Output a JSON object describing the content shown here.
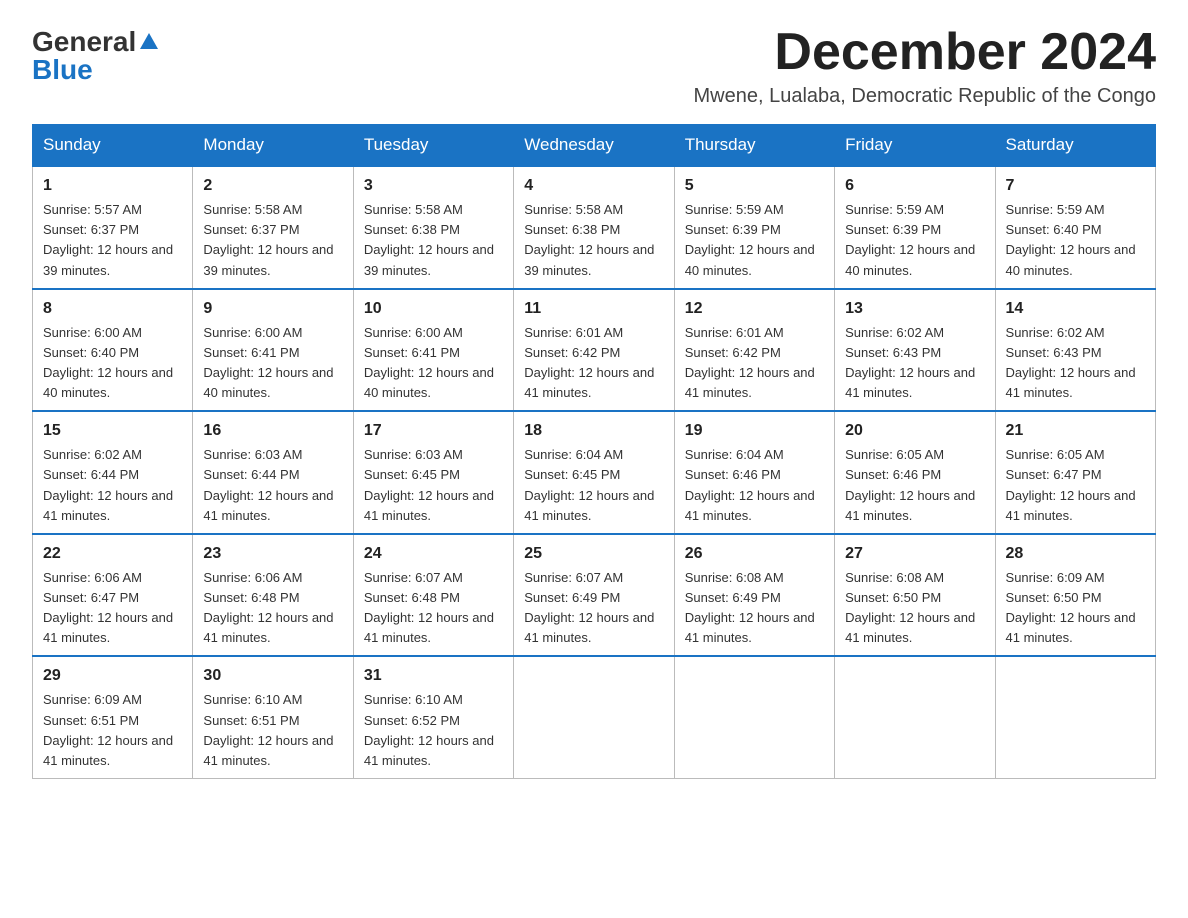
{
  "logo": {
    "general": "General",
    "blue": "Blue"
  },
  "title": "December 2024",
  "location": "Mwene, Lualaba, Democratic Republic of the Congo",
  "days_of_week": [
    "Sunday",
    "Monday",
    "Tuesday",
    "Wednesday",
    "Thursday",
    "Friday",
    "Saturday"
  ],
  "weeks": [
    [
      {
        "day": "1",
        "sunrise": "5:57 AM",
        "sunset": "6:37 PM",
        "daylight": "12 hours and 39 minutes."
      },
      {
        "day": "2",
        "sunrise": "5:58 AM",
        "sunset": "6:37 PM",
        "daylight": "12 hours and 39 minutes."
      },
      {
        "day": "3",
        "sunrise": "5:58 AM",
        "sunset": "6:38 PM",
        "daylight": "12 hours and 39 minutes."
      },
      {
        "day": "4",
        "sunrise": "5:58 AM",
        "sunset": "6:38 PM",
        "daylight": "12 hours and 39 minutes."
      },
      {
        "day": "5",
        "sunrise": "5:59 AM",
        "sunset": "6:39 PM",
        "daylight": "12 hours and 40 minutes."
      },
      {
        "day": "6",
        "sunrise": "5:59 AM",
        "sunset": "6:39 PM",
        "daylight": "12 hours and 40 minutes."
      },
      {
        "day": "7",
        "sunrise": "5:59 AM",
        "sunset": "6:40 PM",
        "daylight": "12 hours and 40 minutes."
      }
    ],
    [
      {
        "day": "8",
        "sunrise": "6:00 AM",
        "sunset": "6:40 PM",
        "daylight": "12 hours and 40 minutes."
      },
      {
        "day": "9",
        "sunrise": "6:00 AM",
        "sunset": "6:41 PM",
        "daylight": "12 hours and 40 minutes."
      },
      {
        "day": "10",
        "sunrise": "6:00 AM",
        "sunset": "6:41 PM",
        "daylight": "12 hours and 40 minutes."
      },
      {
        "day": "11",
        "sunrise": "6:01 AM",
        "sunset": "6:42 PM",
        "daylight": "12 hours and 41 minutes."
      },
      {
        "day": "12",
        "sunrise": "6:01 AM",
        "sunset": "6:42 PM",
        "daylight": "12 hours and 41 minutes."
      },
      {
        "day": "13",
        "sunrise": "6:02 AM",
        "sunset": "6:43 PM",
        "daylight": "12 hours and 41 minutes."
      },
      {
        "day": "14",
        "sunrise": "6:02 AM",
        "sunset": "6:43 PM",
        "daylight": "12 hours and 41 minutes."
      }
    ],
    [
      {
        "day": "15",
        "sunrise": "6:02 AM",
        "sunset": "6:44 PM",
        "daylight": "12 hours and 41 minutes."
      },
      {
        "day": "16",
        "sunrise": "6:03 AM",
        "sunset": "6:44 PM",
        "daylight": "12 hours and 41 minutes."
      },
      {
        "day": "17",
        "sunrise": "6:03 AM",
        "sunset": "6:45 PM",
        "daylight": "12 hours and 41 minutes."
      },
      {
        "day": "18",
        "sunrise": "6:04 AM",
        "sunset": "6:45 PM",
        "daylight": "12 hours and 41 minutes."
      },
      {
        "day": "19",
        "sunrise": "6:04 AM",
        "sunset": "6:46 PM",
        "daylight": "12 hours and 41 minutes."
      },
      {
        "day": "20",
        "sunrise": "6:05 AM",
        "sunset": "6:46 PM",
        "daylight": "12 hours and 41 minutes."
      },
      {
        "day": "21",
        "sunrise": "6:05 AM",
        "sunset": "6:47 PM",
        "daylight": "12 hours and 41 minutes."
      }
    ],
    [
      {
        "day": "22",
        "sunrise": "6:06 AM",
        "sunset": "6:47 PM",
        "daylight": "12 hours and 41 minutes."
      },
      {
        "day": "23",
        "sunrise": "6:06 AM",
        "sunset": "6:48 PM",
        "daylight": "12 hours and 41 minutes."
      },
      {
        "day": "24",
        "sunrise": "6:07 AM",
        "sunset": "6:48 PM",
        "daylight": "12 hours and 41 minutes."
      },
      {
        "day": "25",
        "sunrise": "6:07 AM",
        "sunset": "6:49 PM",
        "daylight": "12 hours and 41 minutes."
      },
      {
        "day": "26",
        "sunrise": "6:08 AM",
        "sunset": "6:49 PM",
        "daylight": "12 hours and 41 minutes."
      },
      {
        "day": "27",
        "sunrise": "6:08 AM",
        "sunset": "6:50 PM",
        "daylight": "12 hours and 41 minutes."
      },
      {
        "day": "28",
        "sunrise": "6:09 AM",
        "sunset": "6:50 PM",
        "daylight": "12 hours and 41 minutes."
      }
    ],
    [
      {
        "day": "29",
        "sunrise": "6:09 AM",
        "sunset": "6:51 PM",
        "daylight": "12 hours and 41 minutes."
      },
      {
        "day": "30",
        "sunrise": "6:10 AM",
        "sunset": "6:51 PM",
        "daylight": "12 hours and 41 minutes."
      },
      {
        "day": "31",
        "sunrise": "6:10 AM",
        "sunset": "6:52 PM",
        "daylight": "12 hours and 41 minutes."
      },
      null,
      null,
      null,
      null
    ]
  ]
}
